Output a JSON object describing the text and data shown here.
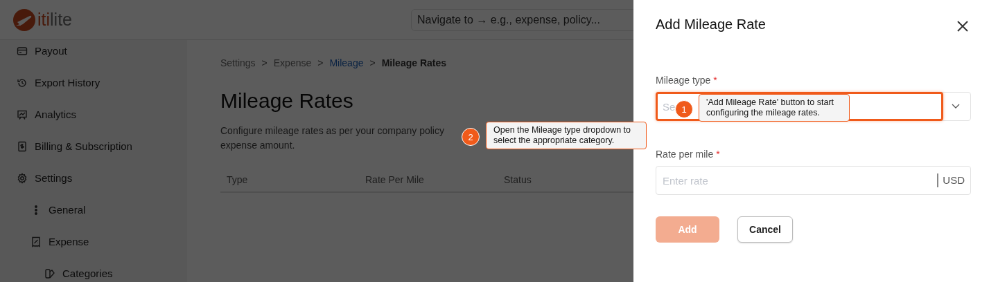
{
  "logo": {
    "parts": [
      {
        "text": "iti",
        "accent": true
      },
      {
        "text": "lite",
        "accent": false
      }
    ]
  },
  "search": {
    "placeholder": "Navigate to → e.g., expense, policy..."
  },
  "sidebar": {
    "items": [
      {
        "label": "Payout"
      },
      {
        "label": "Export History"
      },
      {
        "label": "Analytics"
      },
      {
        "label": "Billing & Subscription"
      },
      {
        "label": "Settings",
        "children": [
          {
            "label": "General"
          },
          {
            "label": "Expense",
            "children": [
              {
                "label": "Categories"
              }
            ]
          }
        ]
      }
    ]
  },
  "breadcrumb": [
    {
      "label": "Settings",
      "kind": "plain"
    },
    {
      "label": "Expense",
      "kind": "plain"
    },
    {
      "label": "Mileage",
      "kind": "link"
    },
    {
      "label": "Mileage Rates",
      "kind": "current"
    }
  ],
  "breadcrumb_separator": ">",
  "page_title": "Mileage Rates",
  "description_lines": [
    "Configure mileage rates as per your company policy",
    "expense amount."
  ],
  "table": {
    "columns": [
      "Type",
      "Rate Per Mile",
      "Status"
    ]
  },
  "drawer": {
    "title": "Add Mileage Rate",
    "required_mark": "*",
    "fields": [
      {
        "label": "Mileage type",
        "kind": "select",
        "placeholder": "Se",
        "highlighted": true
      },
      {
        "label": "Rate per mile",
        "kind": "amount",
        "placeholder": "Enter rate",
        "suffix": "USD",
        "highlighted": false
      }
    ],
    "buttons": [
      {
        "label": "Add",
        "kind": "primary",
        "disabled": true
      },
      {
        "label": "Cancel",
        "kind": "secondary",
        "disabled": false
      }
    ]
  },
  "tour_steps": [
    {
      "number": "1",
      "text": "'Add Mileage Rate' button to start configuring the mileage rates."
    },
    {
      "number": "2",
      "text": "Open the Mileage type dropdown to select the appropriate category."
    }
  ]
}
